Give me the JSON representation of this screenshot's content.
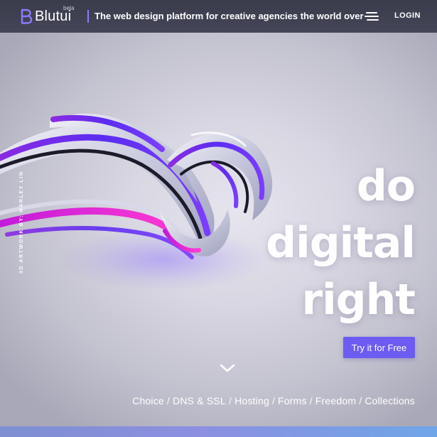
{
  "brand": {
    "name": "Blutui",
    "badge": "beta",
    "accent": "#6d5cf2",
    "divider_color": "#8b7bff"
  },
  "nav": {
    "tagline": "The web design platform for creative agencies the world over",
    "menu_icon": "hamburger-menu-icon",
    "login_label": "LOGIN"
  },
  "hero": {
    "credit": "3D ARTWORK BY: HARLEY LIN",
    "headline": [
      "do",
      "digital",
      "right"
    ],
    "cta_label": "Try it for Free",
    "scroll_icon": "chevron-down-icon"
  },
  "features": [
    "Choice",
    "DNS & SSL",
    "Hosting",
    "Forms",
    "Freedom",
    "Collections"
  ],
  "separator": "/"
}
